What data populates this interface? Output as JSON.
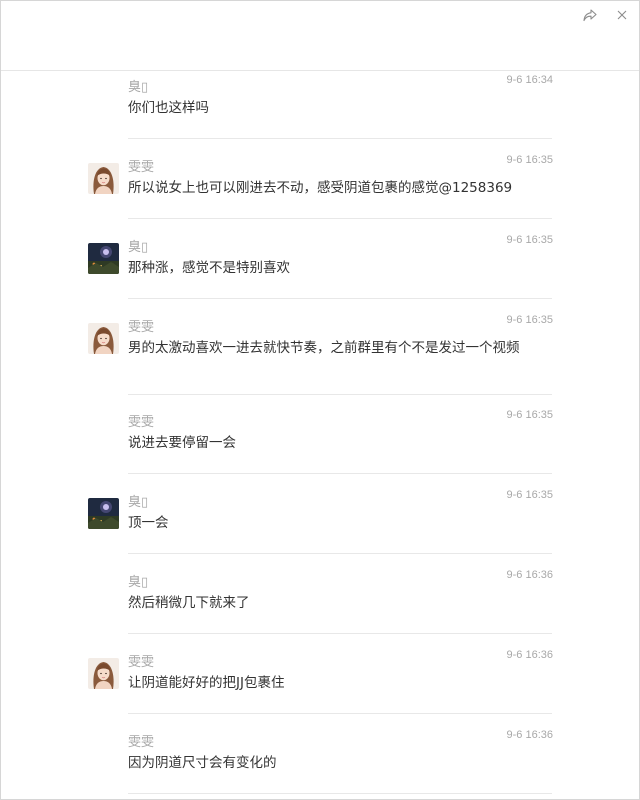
{
  "messages": [
    {
      "sender": "臭▯",
      "time": "9-6 16:34",
      "text": "你们也这样吗",
      "avatar": null
    },
    {
      "sender": "雯雯",
      "time": "9-6 16:35",
      "text": "所以说女上也可以刚进去不动，感受阴道包裹的感觉@1258369",
      "avatar": "girl-avatar"
    },
    {
      "sender": "臭▯",
      "time": "9-6 16:35",
      "text": "那种涨，感觉不是特别喜欢",
      "avatar": "night-scene-avatar"
    },
    {
      "sender": "雯雯",
      "time": "9-6 16:35",
      "text": "男的太激动喜欢一进去就快节奏，之前群里有个不是发过一个视频",
      "avatar": "girl-avatar"
    },
    {
      "sender": "雯雯",
      "time": "9-6 16:35",
      "text": "说进去要停留一会",
      "avatar": null
    },
    {
      "sender": "臭▯",
      "time": "9-6 16:35",
      "text": "顶一会",
      "avatar": "night-scene-avatar"
    },
    {
      "sender": "臭▯",
      "time": "9-6 16:36",
      "text": "然后稍微几下就来了",
      "avatar": null
    },
    {
      "sender": "雯雯",
      "time": "9-6 16:36",
      "text": "让阴道能好好的把JJ包裹住",
      "avatar": "girl-avatar"
    },
    {
      "sender": "雯雯",
      "time": "9-6 16:36",
      "text": "因为阴道尺寸会有变化的",
      "avatar": null
    }
  ],
  "colors": {
    "sender": "#a8a8a8",
    "text": "#333333",
    "divider": "#e8e8e8"
  },
  "icons": {
    "share": "share-arrow-icon",
    "close": "close-icon"
  }
}
